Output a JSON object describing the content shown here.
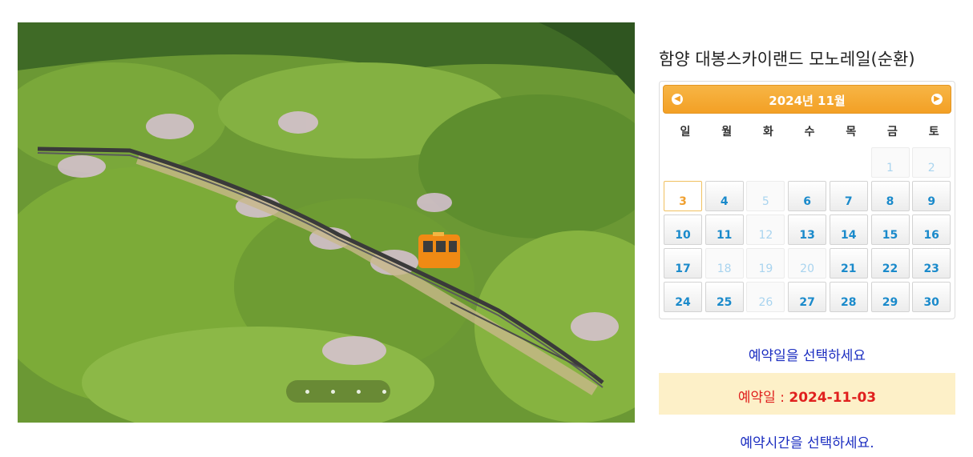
{
  "product": {
    "title": "함양 대봉스카이랜드 모노레일(순환)"
  },
  "photo": {
    "description_icon": "monorail-photo",
    "slides": 4
  },
  "calendar": {
    "month_label": "2024년 11월",
    "prev_icon": "arrow-left-icon",
    "next_icon": "arrow-right-icon",
    "weekdays": [
      "일",
      "월",
      "화",
      "수",
      "목",
      "금",
      "토"
    ],
    "days": [
      {
        "d": "1",
        "state": "off"
      },
      {
        "d": "2",
        "state": "off"
      },
      {
        "d": "3",
        "state": "today"
      },
      {
        "d": "4",
        "state": "on"
      },
      {
        "d": "5",
        "state": "off"
      },
      {
        "d": "6",
        "state": "on"
      },
      {
        "d": "7",
        "state": "on"
      },
      {
        "d": "8",
        "state": "on"
      },
      {
        "d": "9",
        "state": "on"
      },
      {
        "d": "10",
        "state": "on"
      },
      {
        "d": "11",
        "state": "on"
      },
      {
        "d": "12",
        "state": "off"
      },
      {
        "d": "13",
        "state": "on"
      },
      {
        "d": "14",
        "state": "on"
      },
      {
        "d": "15",
        "state": "on"
      },
      {
        "d": "16",
        "state": "on"
      },
      {
        "d": "17",
        "state": "on"
      },
      {
        "d": "18",
        "state": "off"
      },
      {
        "d": "19",
        "state": "off"
      },
      {
        "d": "20",
        "state": "off"
      },
      {
        "d": "21",
        "state": "on"
      },
      {
        "d": "22",
        "state": "on"
      },
      {
        "d": "23",
        "state": "on"
      },
      {
        "d": "24",
        "state": "on"
      },
      {
        "d": "25",
        "state": "on"
      },
      {
        "d": "26",
        "state": "off"
      },
      {
        "d": "27",
        "state": "on"
      },
      {
        "d": "28",
        "state": "on"
      },
      {
        "d": "29",
        "state": "on"
      },
      {
        "d": "30",
        "state": "on"
      }
    ],
    "first_weekday_index": 5
  },
  "booking": {
    "choose_date_text": "예약일을 선택하세요",
    "selected_label": "예약일 : ",
    "selected_value": "2024-11-03",
    "choose_time_text": "예약시간을 선택하세요."
  },
  "colors": {
    "accent": "#f3a025",
    "link": "#1a2cc0",
    "day": "#1a8acb",
    "selected_bg": "#fdf0c8",
    "selected_text": "#e0201e"
  }
}
